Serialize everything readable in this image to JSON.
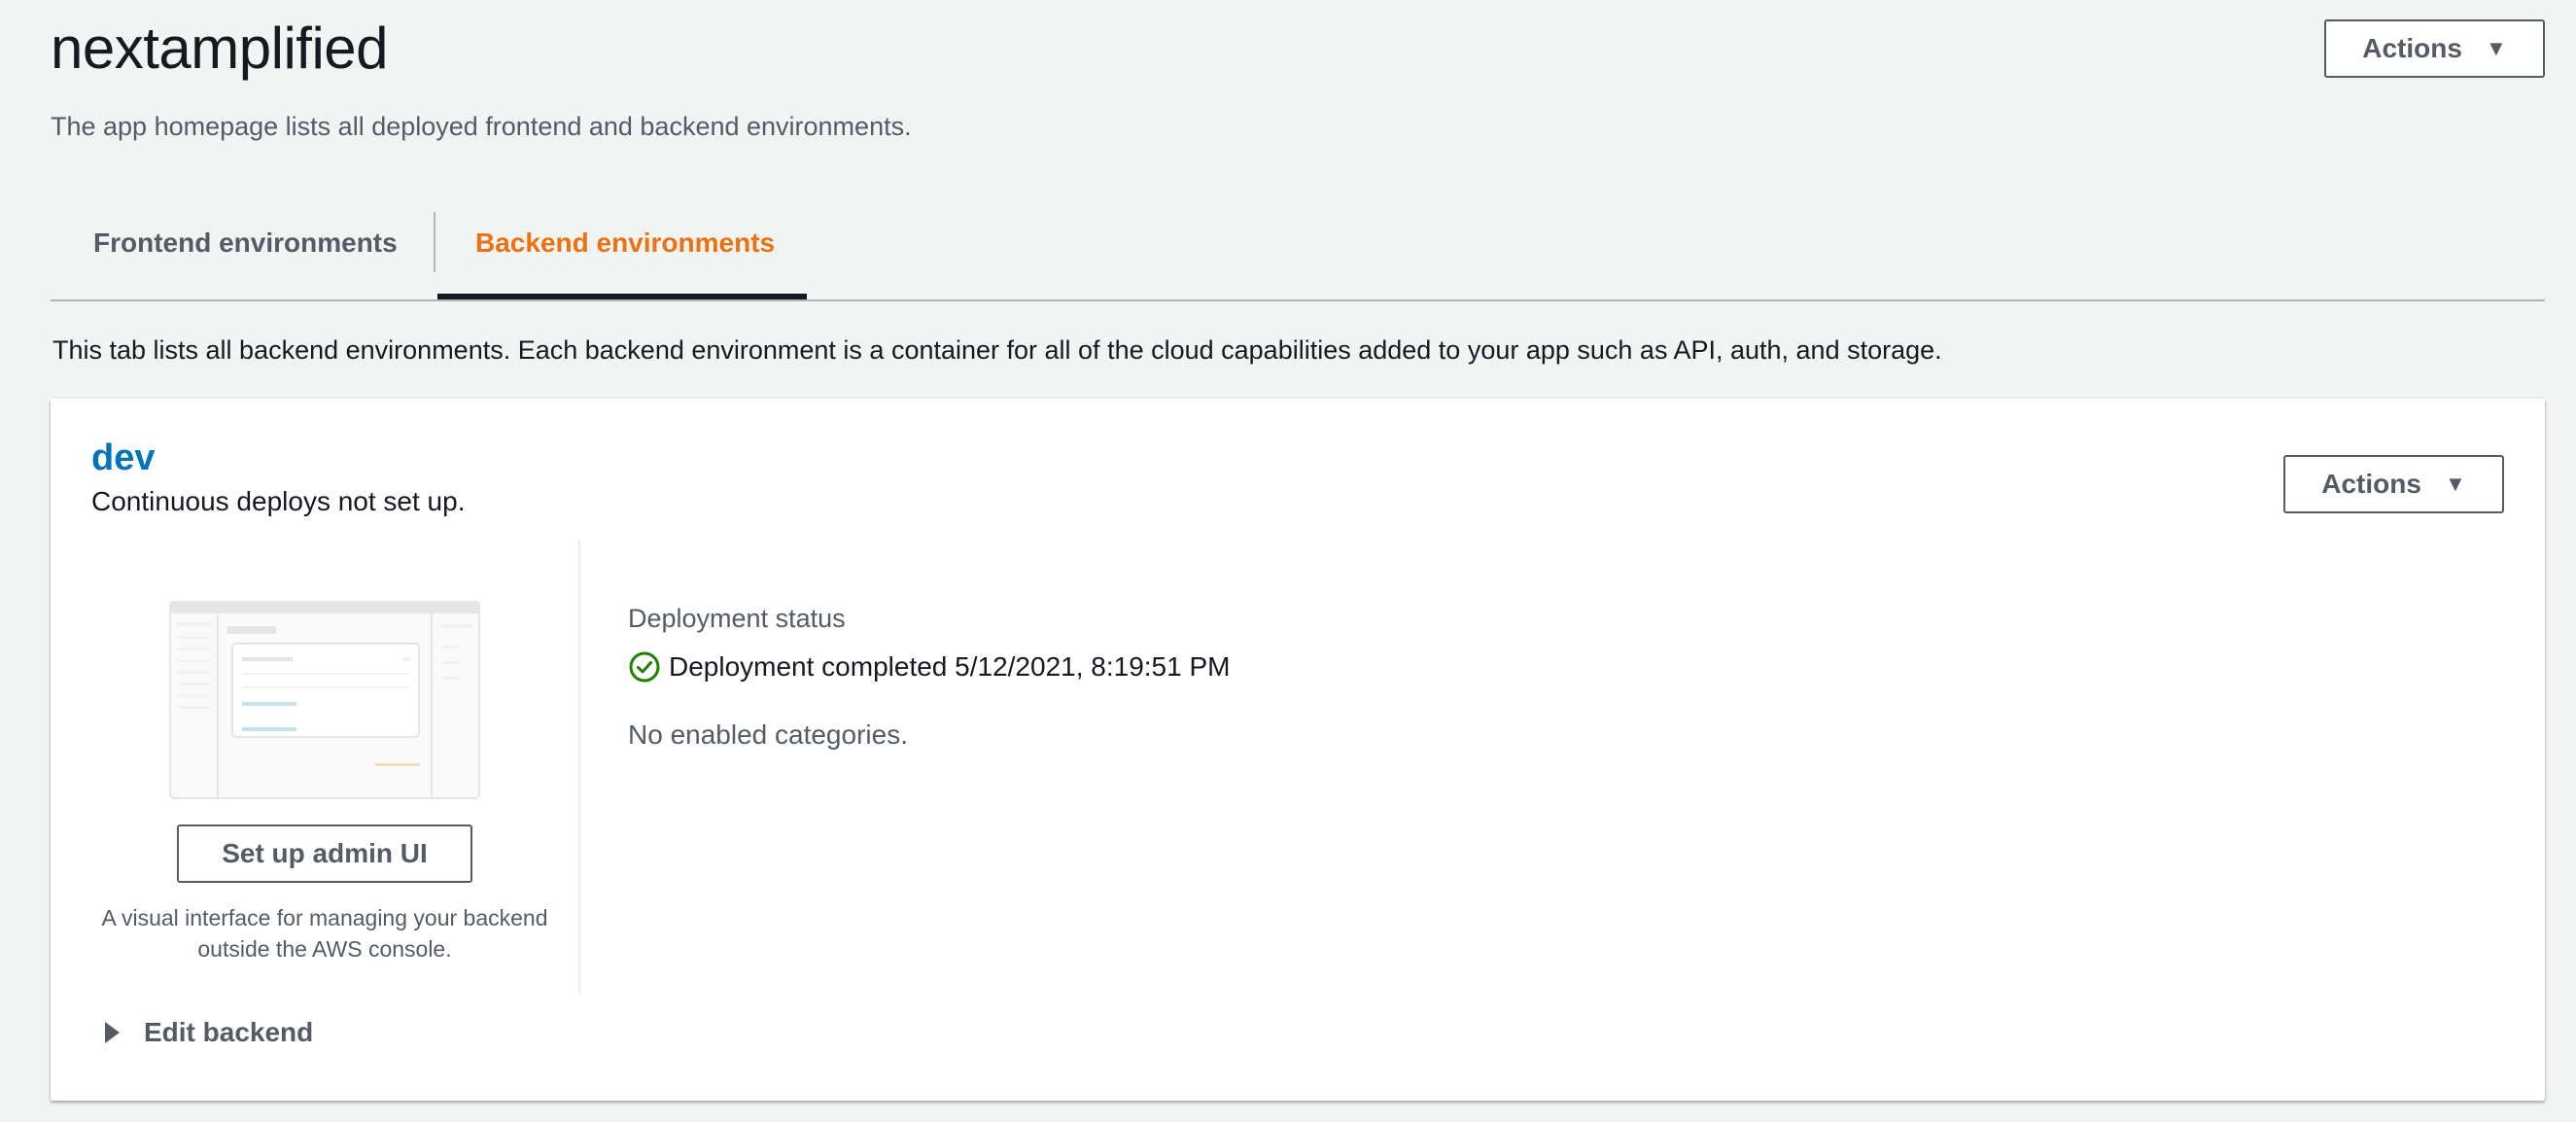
{
  "page": {
    "title": "nextamplified",
    "subtitle": "The app homepage lists all deployed frontend and backend environments.",
    "actions_label": "Actions"
  },
  "tabs": [
    {
      "label": "Frontend environments",
      "active": false
    },
    {
      "label": "Backend environments",
      "active": true
    }
  ],
  "tab_description": "This tab lists all backend environments. Each backend environment is a container for all of the cloud capabilities added to your app such as API, auth, and storage.",
  "environment": {
    "name": "dev",
    "subtitle": "Continuous deploys not set up.",
    "actions_label": "Actions",
    "admin_button_label": "Set up admin UI",
    "admin_description": "A visual interface for managing your backend outside the AWS console.",
    "edit_backend_label": "Edit backend",
    "deployment_label": "Deployment status",
    "deployment_status": "Deployment completed 5/12/2021, 8:19:51 PM",
    "categories_text": "No enabled categories."
  },
  "colors": {
    "accent_orange": "#ec7211",
    "link_blue": "#0073bb",
    "success_green": "#1d8102"
  }
}
